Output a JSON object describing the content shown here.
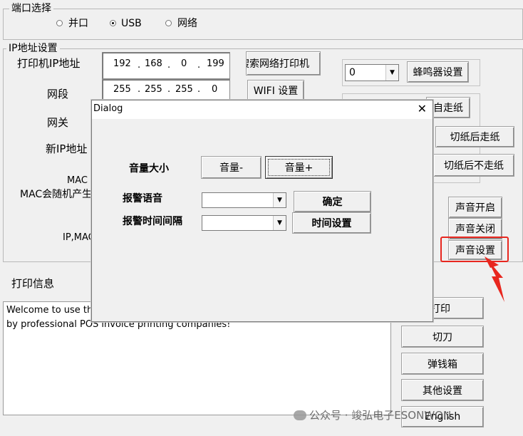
{
  "port": {
    "legend": "端口选择",
    "options": [
      {
        "label": "并口",
        "selected": false
      },
      {
        "label": "USB",
        "selected": true
      },
      {
        "label": "网络",
        "selected": false
      }
    ]
  },
  "ip": {
    "legend": "IP地址设置",
    "printer_ip_label": "打印机IP地址",
    "printer_ip": [
      "192",
      "168",
      "0",
      "199"
    ],
    "subnet_label": "网段",
    "subnet": [
      "255",
      "255",
      "255",
      "0"
    ],
    "gateway_label": "网关",
    "new_ip_label": "新IP地址",
    "mac_label": "MAC",
    "mac_note": "MAC会随机产生",
    "ipmac_label": "IP,MAC",
    "search_button": "搜索网络打印机",
    "wifi_button": "WIFI 设置"
  },
  "right_panel": {
    "buzzer_value": "0",
    "buzzer_button": "蜂鸣器设置",
    "auto_feed_button": "自走纸",
    "cut_after_feed_button": "切纸后走纸",
    "cut_no_feed_button": "切纸后不走纸",
    "sound_on_button": "声音开启",
    "sound_off_button": "声音关闭",
    "sound_settings_button": "声音设置",
    "highlight_color": "#e8271f"
  },
  "print_info": {
    "label": "打印信息",
    "text_line1": "Welcome to use the n",
    "text_line2": "by professional POS invoice printing companies!"
  },
  "actions": {
    "print_button": "打印",
    "cut_button": "切刀",
    "cash_drawer_button": "弹钱箱",
    "other_settings_button": "其他设置",
    "english_button": "English"
  },
  "watermark": "公众号 · 竣弘电子ESONWON",
  "dialog": {
    "title": "Dialog",
    "volume_label": "音量大小",
    "volume_down": "音量-",
    "volume_up": "音量+",
    "alarm_voice_label": "报警语音",
    "alarm_voice_value": "",
    "confirm_button": "确定",
    "alarm_interval_label": "报警时间间隔",
    "alarm_interval_value": "",
    "time_set_button": "时间设置"
  }
}
